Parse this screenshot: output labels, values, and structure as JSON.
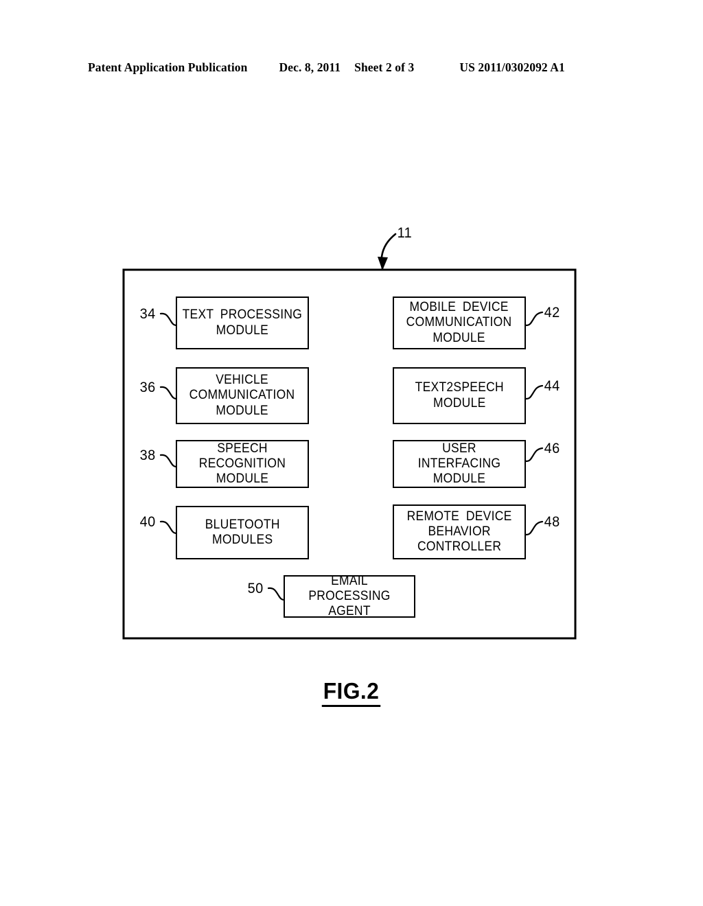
{
  "header": {
    "publication": "Patent Application Publication",
    "date": "Dec. 8, 2011",
    "sheet": "Sheet 2 of 3",
    "patent_number": "US 2011/0302092 A1"
  },
  "figure": {
    "caption": "FIG.2",
    "container_ref": "11",
    "modules": [
      {
        "ref": "34",
        "label": "TEXT  PROCESSING\nMODULE",
        "column": "left",
        "row": 1
      },
      {
        "ref": "36",
        "label": "VEHICLE\nCOMMUNICATION\nMODULE",
        "column": "left",
        "row": 2
      },
      {
        "ref": "38",
        "label": "SPEECH  RECOGNITION\nMODULE",
        "column": "left",
        "row": 3
      },
      {
        "ref": "40",
        "label": "BLUETOOTH\nMODULES",
        "column": "left",
        "row": 4
      },
      {
        "ref": "42",
        "label": "MOBILE  DEVICE\nCOMMUNICATION\nMODULE",
        "column": "right",
        "row": 1
      },
      {
        "ref": "44",
        "label": "TEXT2SPEECH\nMODULE",
        "column": "right",
        "row": 2
      },
      {
        "ref": "46",
        "label": "USER  INTERFACING\nMODULE",
        "column": "right",
        "row": 3
      },
      {
        "ref": "48",
        "label": "REMOTE  DEVICE\nBEHAVIOR\nCONTROLLER",
        "column": "right",
        "row": 4
      },
      {
        "ref": "50",
        "label": "EMAIL  PROCESSING\nAGENT",
        "column": "center",
        "row": 5
      }
    ]
  },
  "colors": {
    "ink": "#000000",
    "paper": "#ffffff"
  }
}
